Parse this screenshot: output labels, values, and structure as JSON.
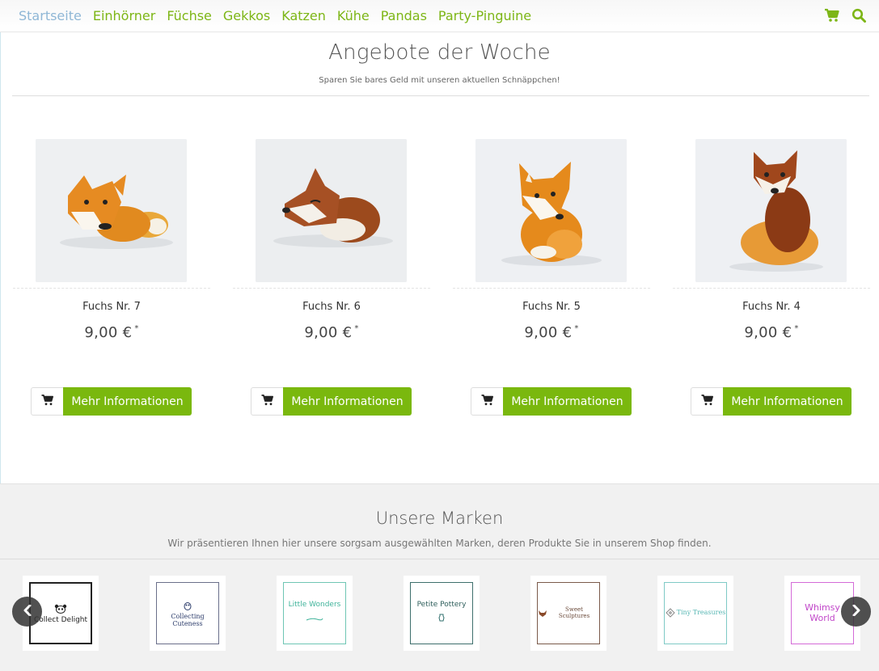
{
  "nav": {
    "items": [
      {
        "label": "Startseite",
        "active": true
      },
      {
        "label": "Einhörner"
      },
      {
        "label": "Füchse"
      },
      {
        "label": "Gekkos"
      },
      {
        "label": "Katzen"
      },
      {
        "label": "Kühe"
      },
      {
        "label": "Pandas"
      },
      {
        "label": "Party-Pinguine"
      }
    ],
    "icons": [
      "cart-icon",
      "search-icon"
    ]
  },
  "offers": {
    "title": "Angebote der Woche",
    "subtitle": "Sparen Sie bares Geld mit unseren aktuellen Schnäppchen!"
  },
  "products": [
    {
      "name": "Fuchs Nr. 7",
      "price": "9,00 €",
      "star": "*",
      "button": "Mehr Informationen"
    },
    {
      "name": "Fuchs Nr. 6",
      "price": "9,00 €",
      "star": "*",
      "button": "Mehr Informationen"
    },
    {
      "name": "Fuchs Nr. 5",
      "price": "9,00 €",
      "star": "*",
      "button": "Mehr Informationen"
    },
    {
      "name": "Fuchs Nr. 4",
      "price": "9,00 €",
      "star": "*",
      "button": "Mehr Informationen"
    }
  ],
  "brands": {
    "title": "Unsere Marken",
    "subtitle": "Wir präsentieren Ihnen hier unsere sorgsam ausgewählten Marken, deren Produkte Sie in unserem Shop finden.",
    "items": [
      {
        "name": "Collect Delight",
        "color": "#222222"
      },
      {
        "name": "Collecting Cuteness",
        "color": "#2b3b6a"
      },
      {
        "name": "Little Wonders",
        "color": "#3fb39a"
      },
      {
        "name": "Petite Pottery",
        "color": "#2f6f6c"
      },
      {
        "name": "Sweet Sculptures",
        "color": "#6b4a3a"
      },
      {
        "name": "Tiny Treasures",
        "color": "#58b7b4"
      },
      {
        "name": "Whimsy World",
        "color": "#c146c9"
      }
    ]
  },
  "colors": {
    "accent": "#7ab80e",
    "nav_link": "#7db616",
    "nav_active": "#8fb7d6"
  }
}
